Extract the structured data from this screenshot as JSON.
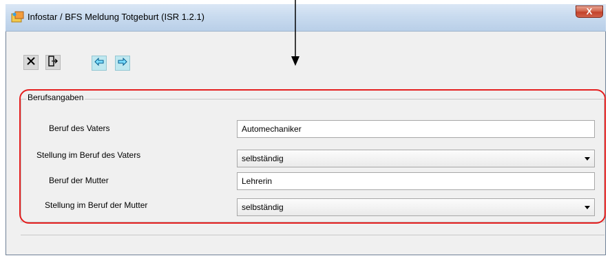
{
  "window": {
    "title": "Infostar / BFS Meldung Totgeburt (ISR 1.2.1)",
    "close_label": "X"
  },
  "toolbar": {
    "icons": [
      "close-x-icon",
      "exit-door-icon",
      "arrow-left-icon",
      "arrow-right-icon"
    ]
  },
  "group": {
    "label": "Berufsangaben",
    "fields": [
      {
        "label": "Beruf des Vaters",
        "value": "Automechaniker",
        "type": "text"
      },
      {
        "label": "Stellung im Beruf des Vaters",
        "value": "selbständig",
        "type": "select"
      },
      {
        "label": "Beruf der Mutter",
        "value": "Lehrerin",
        "type": "text"
      },
      {
        "label": "Stellung im Beruf der Mutter",
        "value": "selbständig",
        "type": "select"
      }
    ]
  },
  "colors": {
    "highlight": "#e41e1e",
    "titlebar": "#c9dbef",
    "close_button": "#c3412a"
  }
}
